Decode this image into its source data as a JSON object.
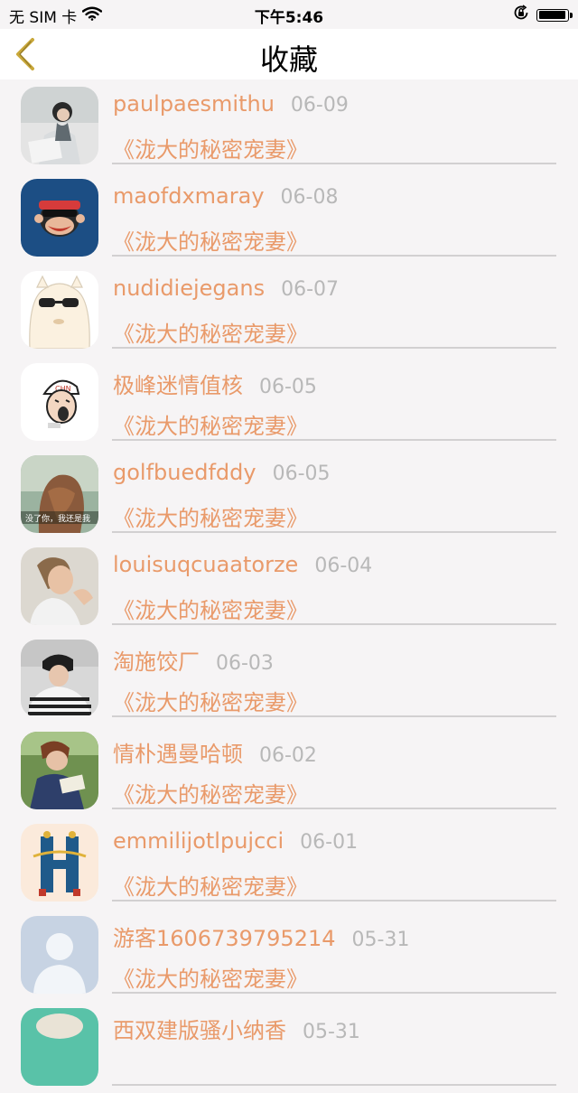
{
  "status_bar": {
    "carrier": "无 SIM 卡",
    "time": "下午5:46",
    "battery_level": 0.95
  },
  "nav": {
    "title": "收藏",
    "back_icon": "chevron-left-icon"
  },
  "colors": {
    "accent": "#e99a6a",
    "date": "#b8b8b8",
    "divider": "#d2d0d1",
    "background": "#f6f4f5",
    "back_icon": "#c9a83a"
  },
  "favorites": [
    {
      "user": "paulpaesmithu",
      "date": "06-09",
      "book": "《泷大的秘密宠妻》",
      "avatar": "photo-woman-reading"
    },
    {
      "user": "maofdxmaray",
      "date": "06-08",
      "book": "《泷大的秘密宠妻》",
      "avatar": "monkey-cartoon"
    },
    {
      "user": "nudidiejegans",
      "date": "06-07",
      "book": "《泷大的秘密宠妻》",
      "avatar": "alpaca-sunglasses"
    },
    {
      "user": "极峰迷情值核",
      "date": "06-05",
      "book": "《泷大的秘密宠妻》",
      "avatar": "cartoon-face-cap"
    },
    {
      "user": "golfbuedfddy",
      "date": "06-05",
      "book": "《泷大的秘密宠妻》",
      "avatar": "photo-girl-hair",
      "avatar_caption": "没了你，我还是我"
    },
    {
      "user": "louisuqcuaatorze",
      "date": "06-04",
      "book": "《泷大的秘密宠妻》",
      "avatar": "photo-woman-smiling"
    },
    {
      "user": "淘施饺厂",
      "date": "06-03",
      "book": "《泷大的秘密宠妻》",
      "avatar": "photo-man-striped"
    },
    {
      "user": "情朴遇曼哈顿",
      "date": "06-02",
      "book": "《泷大的秘密宠妻》",
      "avatar": "photo-woman-grass"
    },
    {
      "user": "emmilijotlpujcci",
      "date": "06-01",
      "book": "《泷大的秘密宠妻》",
      "avatar": "letter-h-illustration"
    },
    {
      "user": "游客1606739795214",
      "date": "05-31",
      "book": "《泷大的秘密宠妻》",
      "avatar": "default-person"
    },
    {
      "user": "西双建版骚小纳香",
      "date": "05-31",
      "book": "",
      "avatar": "photo-partial"
    }
  ]
}
